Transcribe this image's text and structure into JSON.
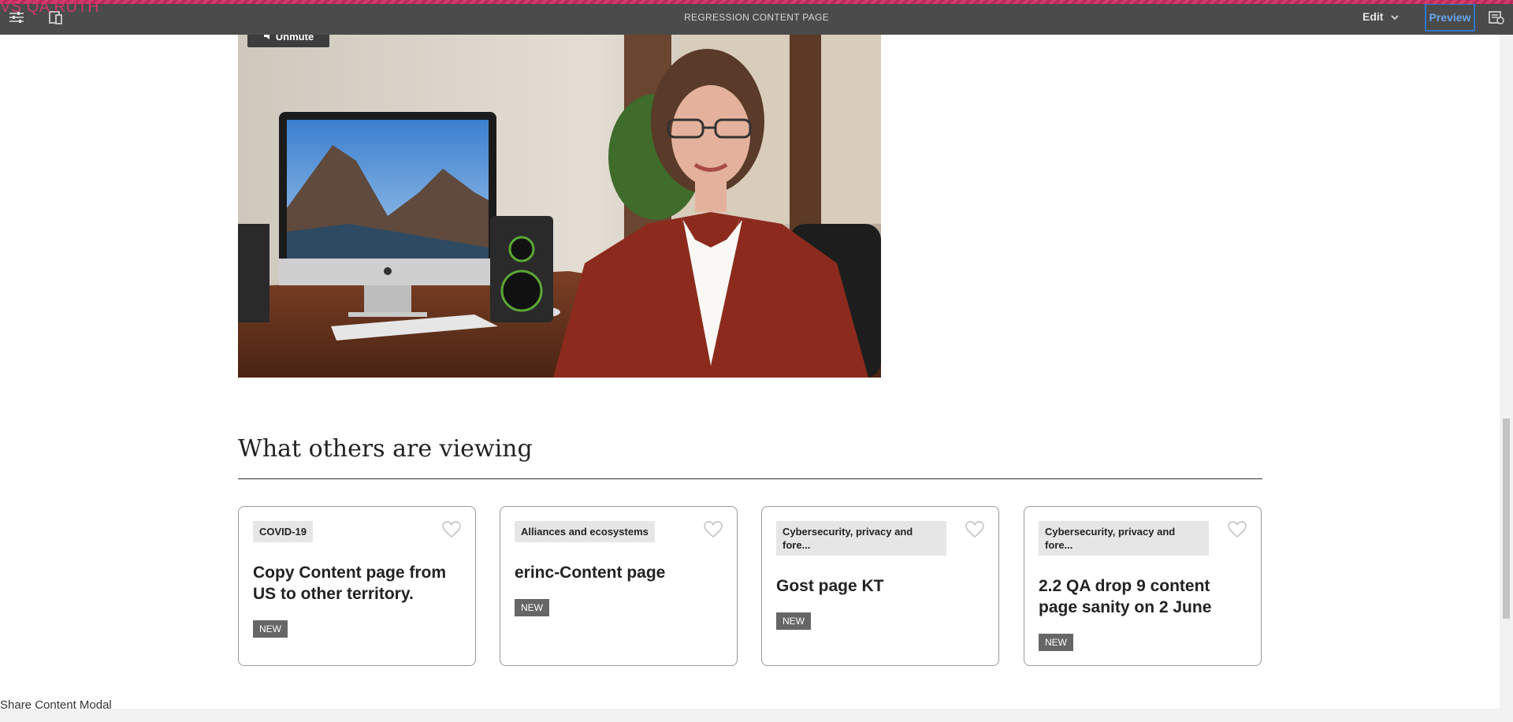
{
  "environment_label": "VS QA RUTH",
  "toolbar": {
    "title": "REGRESSION CONTENT PAGE",
    "mode_label": "Edit",
    "preview_label": "Preview",
    "icons": [
      "sliders-icon",
      "device-emulator-icon",
      "chevron-down-icon",
      "page-info-icon"
    ]
  },
  "video": {
    "unmute_label": "Unmute",
    "icons": [
      "speaker-icon"
    ]
  },
  "section": {
    "title": "What others are viewing"
  },
  "cards": [
    {
      "tag": "COVID-19",
      "title": "Copy Content page from US to other territory.",
      "badge": "NEW"
    },
    {
      "tag": "Alliances and ecosystems",
      "title": "erinc-Content page",
      "badge": "NEW"
    },
    {
      "tag": "Cybersecurity, privacy and fore...",
      "title": "Gost page KT",
      "badge": "NEW"
    },
    {
      "tag": "Cybersecurity, privacy and fore...",
      "title": "2.2 QA drop 9 content page sanity on 2 June",
      "badge": "NEW"
    }
  ],
  "footer": {
    "text": "Share Content Modal"
  },
  "colors": {
    "toolbar_bg": "#4b4b4b",
    "preview_accent": "#2f78c9",
    "env_label": "#d1386a",
    "badge_bg": "#666666",
    "tag_bg": "#e6e6e6"
  }
}
